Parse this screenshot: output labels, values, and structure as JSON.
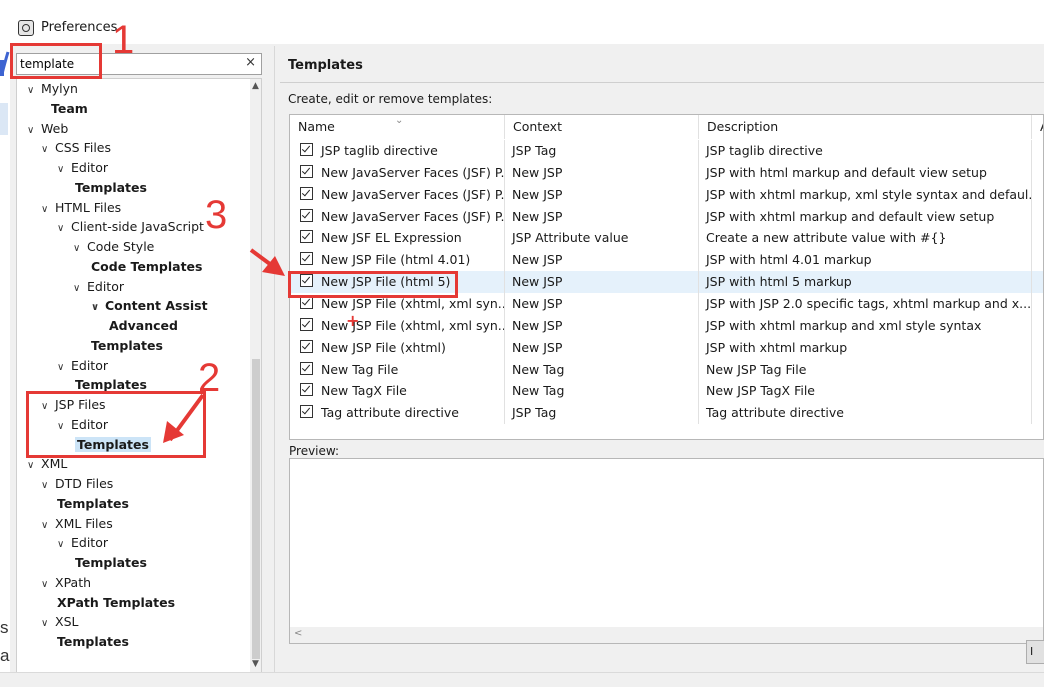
{
  "window": {
    "title": "Preferences"
  },
  "search": {
    "value": "template",
    "clear_glyph": "×"
  },
  "tree": {
    "collapse_glyph": "∨",
    "items": [
      {
        "label": "Mylyn",
        "expanded": true
      },
      {
        "label": "Team"
      },
      {
        "label": "Web",
        "expanded": true
      },
      {
        "label": "CSS Files",
        "expanded": true
      },
      {
        "label": "Editor",
        "expanded": true
      },
      {
        "label": "Templates"
      },
      {
        "label": "HTML Files",
        "expanded": true
      },
      {
        "label": "Client-side JavaScript",
        "expanded": true
      },
      {
        "label": "Code Style",
        "expanded": true
      },
      {
        "label": "Code Templates"
      },
      {
        "label": "Editor",
        "expanded": true
      },
      {
        "label": "Content Assist",
        "expanded": true
      },
      {
        "label": "Advanced"
      },
      {
        "label": "Templates"
      },
      {
        "label": "Editor",
        "expanded": true
      },
      {
        "label": "Templates"
      },
      {
        "label": "JSP Files",
        "expanded": true
      },
      {
        "label": "Editor",
        "expanded": true
      },
      {
        "label": "Templates",
        "selected": true
      },
      {
        "label": "XML",
        "expanded": true
      },
      {
        "label": "DTD Files",
        "expanded": true
      },
      {
        "label": "Templates"
      },
      {
        "label": "XML Files",
        "expanded": true
      },
      {
        "label": "Editor",
        "expanded": true
      },
      {
        "label": "Templates"
      },
      {
        "label": "XPath",
        "expanded": true
      },
      {
        "label": "XPath Templates"
      },
      {
        "label": "XSL",
        "expanded": true
      },
      {
        "label": "Templates"
      }
    ]
  },
  "page": {
    "title": "Templates",
    "description": "Create, edit or remove templates:",
    "preview_label": "Preview:",
    "hscroll_left_glyph": "<"
  },
  "table": {
    "columns": [
      "Name",
      "Context",
      "Description",
      "A"
    ],
    "rows": [
      {
        "name": "JSP taglib directive",
        "context": "JSP Tag",
        "description": "JSP taglib directive",
        "checked": true
      },
      {
        "name": "New JavaServer Faces (JSF) P...",
        "context": "New JSP",
        "description": "JSP with html markup and default view setup",
        "checked": true
      },
      {
        "name": "New JavaServer Faces (JSF) P...",
        "context": "New JSP",
        "description": "JSP with xhtml markup, xml style syntax and defaul...",
        "checked": true
      },
      {
        "name": "New JavaServer Faces (JSF) P...",
        "context": "New JSP",
        "description": "JSP with xhtml markup and default view setup",
        "checked": true
      },
      {
        "name": "New JSF EL Expression",
        "context": "JSP Attribute value",
        "description": "Create a new attribute value with #{}",
        "checked": true
      },
      {
        "name": "New JSP File (html 4.01)",
        "context": "New JSP",
        "description": "JSP with html 4.01 markup",
        "checked": true
      },
      {
        "name": "New JSP File (html 5)",
        "context": "New JSP",
        "description": "JSP with html 5 markup",
        "checked": true,
        "selected": true
      },
      {
        "name": "New JSP File (xhtml, xml syn...",
        "context": "New JSP",
        "description": "JSP with JSP 2.0 specific tags, xhtml markup and x...",
        "checked": true
      },
      {
        "name": "New JSP File (xhtml, xml syn...",
        "context": "New JSP",
        "description": "JSP with xhtml markup and xml style syntax",
        "checked": true
      },
      {
        "name": "New JSP File (xhtml)",
        "context": "New JSP",
        "description": "JSP with xhtml markup",
        "checked": true
      },
      {
        "name": "New Tag File",
        "context": "New Tag",
        "description": "New JSP Tag File",
        "checked": true
      },
      {
        "name": "New TagX File",
        "context": "New Tag",
        "description": "New JSP TagX File",
        "checked": true
      },
      {
        "name": "Tag attribute directive",
        "context": "JSP Tag",
        "description": "Tag attribute directive",
        "checked": true
      }
    ]
  },
  "right_button": {
    "label": "I"
  },
  "background_fragments": [
    "s",
    "a"
  ],
  "annotations": {
    "numbers": [
      "1",
      "2",
      "3"
    ],
    "color": "#e53935"
  },
  "colors": {
    "selection": "#cce4f7",
    "row_selection": "#e5f1fb",
    "annotation": "#e53935"
  }
}
